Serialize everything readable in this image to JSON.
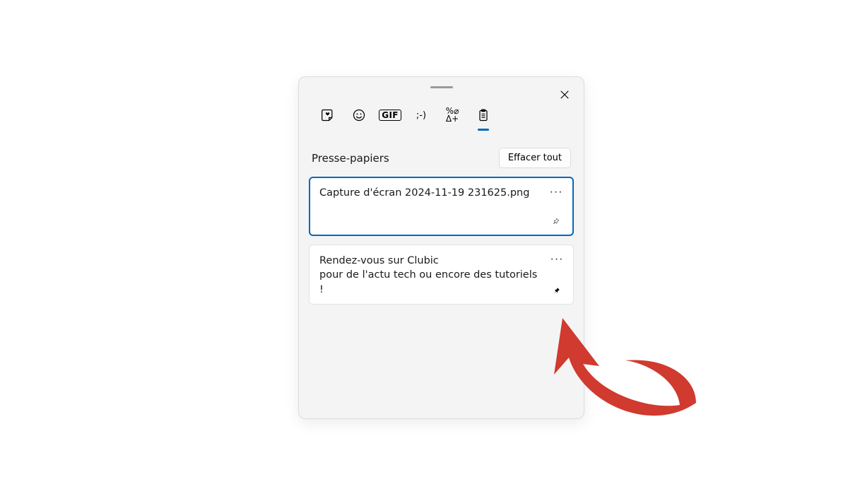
{
  "panel": {
    "section_title": "Presse-papiers",
    "clear_all_label": "Effacer tout",
    "tabs": [
      {
        "name": "recent",
        "active": false
      },
      {
        "name": "emoji",
        "active": false
      },
      {
        "name": "gif",
        "label": "GIF",
        "active": false
      },
      {
        "name": "kaomoji",
        "label": ";-)",
        "active": false
      },
      {
        "name": "symbols",
        "active": false
      },
      {
        "name": "clipboard",
        "active": true
      }
    ],
    "items": [
      {
        "text": "Capture d'écran 2024-11-19 231625.png",
        "selected": true,
        "pinned": false
      },
      {
        "text": "Rendez-vous sur Clubic\npour de l'actu tech ou encore des tutoriels !",
        "selected": false,
        "pinned": true
      }
    ]
  },
  "annotation": {
    "arrow_color": "#d03a2f"
  }
}
